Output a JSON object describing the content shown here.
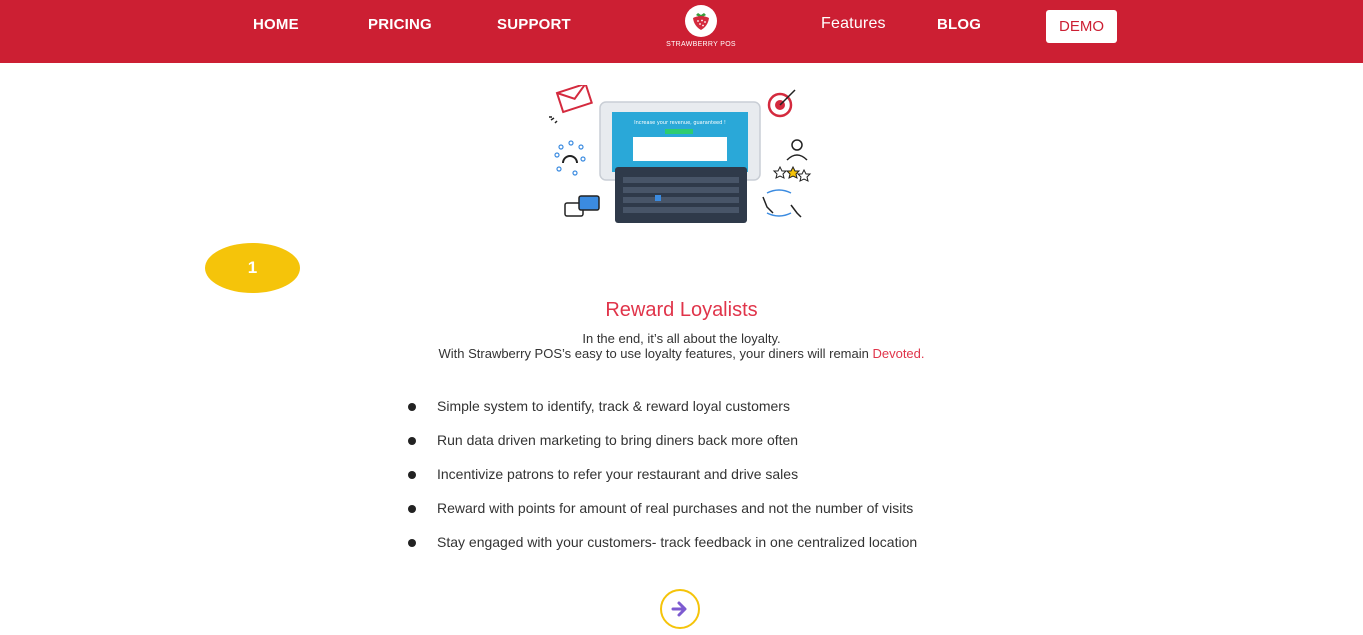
{
  "nav": {
    "home": "HOME",
    "pricing": "PRICING",
    "support": "SUPPORT",
    "features": "Features",
    "blog": "BLOG",
    "demo": "DEMO"
  },
  "logo": {
    "text": "STRAWBERRY POS"
  },
  "hero": {
    "screen_text": "Increase your revenue, guaranteed !"
  },
  "step": {
    "number": "1"
  },
  "section": {
    "title": "Reward Loyalists",
    "line1": "In the end, it’s all about the loyalty.",
    "line2": "With Strawberry POS’s easy to use loyalty features, your diners will remain ",
    "line2_accent": "Devoted."
  },
  "features": [
    "Simple system to identify, track & reward loyal customers",
    "Run data driven marketing to bring diners back more often",
    "Incentivize patrons to refer your restaurant and drive sales",
    "Reward with points for amount of real purchases and not the number of visits",
    "Stay engaged with your customers- track feedback in one centralized location"
  ],
  "colors": {
    "brand_red": "#cc1f33",
    "accent_red": "#e0344a",
    "badge_yellow": "#f5c40a",
    "arrow_purple": "#7d5bd0"
  },
  "icons": {
    "logo": "strawberry-icon",
    "next": "arrow-right-icon"
  }
}
